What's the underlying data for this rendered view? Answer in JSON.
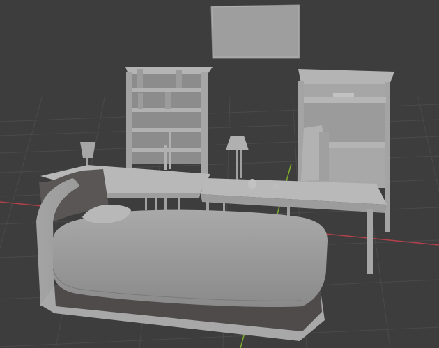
{
  "viewport": {
    "label": "",
    "background": "#3d3d3d",
    "grid_color": "#4a4a4a",
    "x_axis_color": "#b3404a",
    "y_axis_color": "#7fae2c",
    "object_color": "#a8a8a8"
  },
  "scene": {
    "objects": [
      {
        "name": "wall-frame",
        "icon": "frame-icon"
      },
      {
        "name": "bookshelf"
      },
      {
        "name": "hutch"
      },
      {
        "name": "table-lamp"
      },
      {
        "name": "desk-lamp"
      },
      {
        "name": "writing-desk"
      },
      {
        "name": "dining-table"
      },
      {
        "name": "chair"
      },
      {
        "name": "bed"
      },
      {
        "name": "pillow"
      },
      {
        "name": "cup"
      }
    ]
  }
}
